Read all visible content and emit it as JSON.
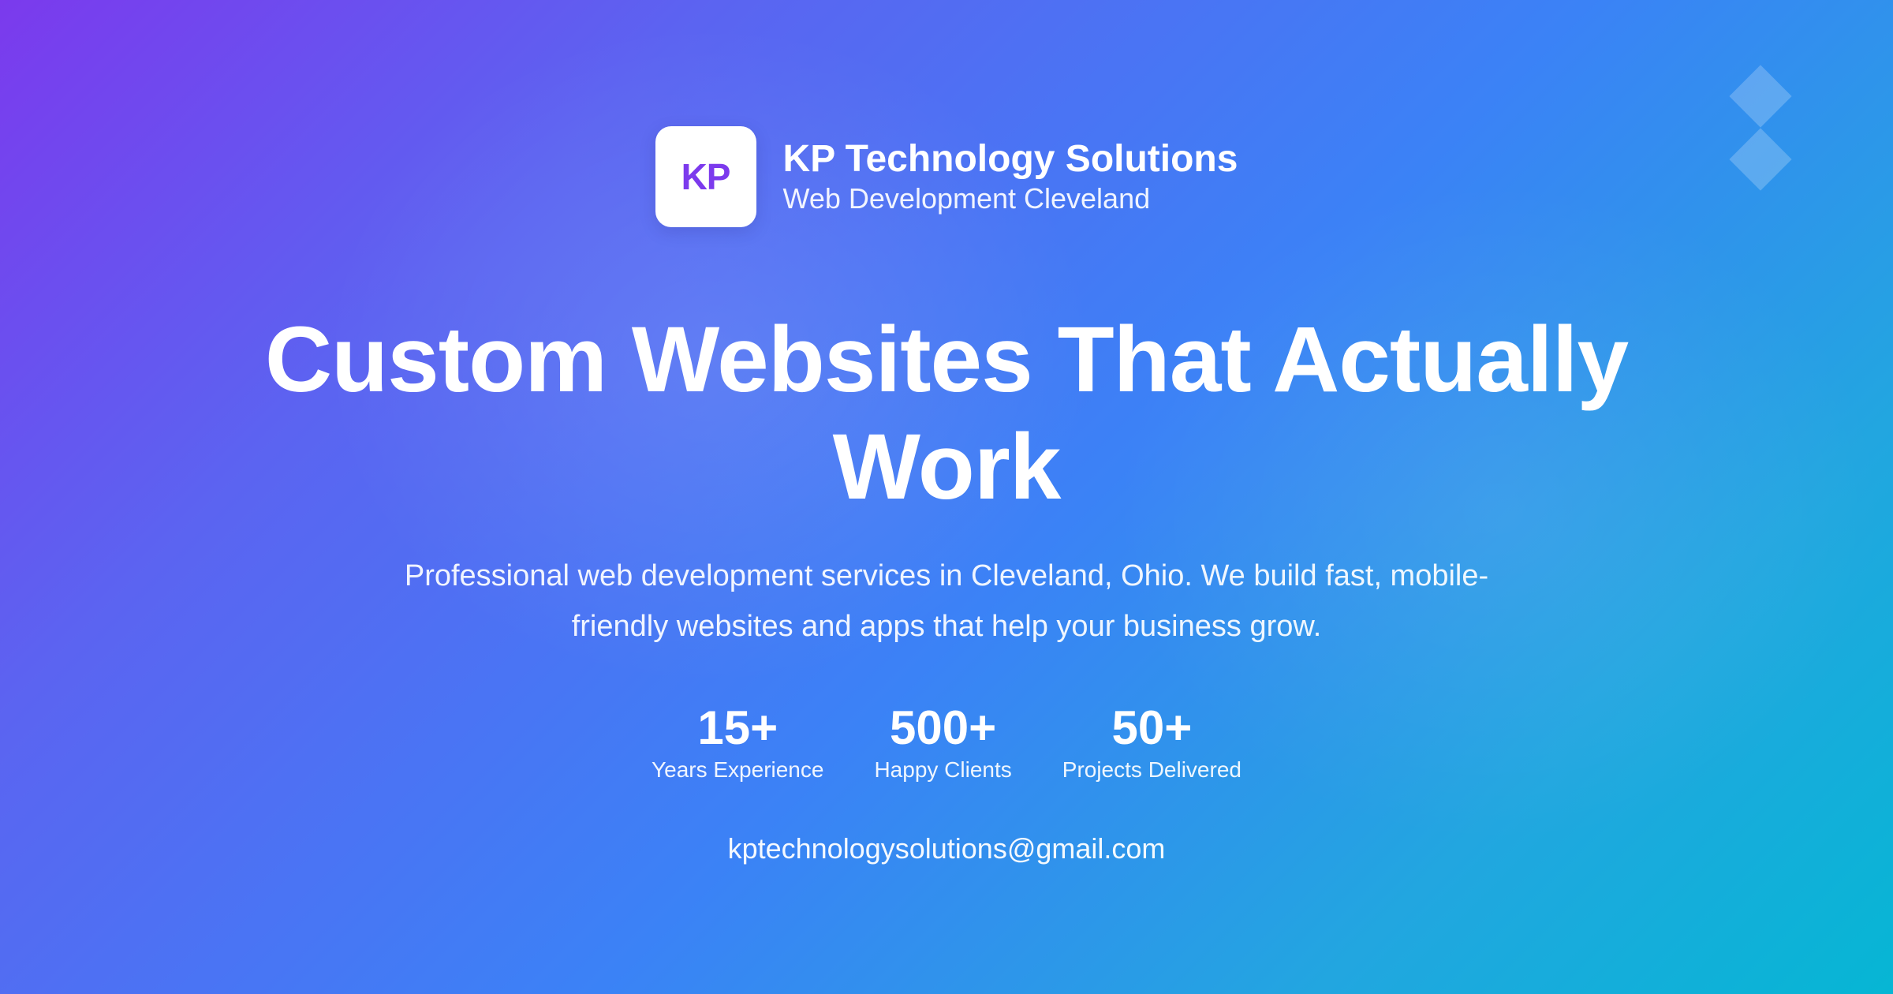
{
  "brand": {
    "logo_initials": "KP",
    "name": "KP Technology Solutions",
    "tagline": "Web Development Cleveland"
  },
  "hero": {
    "headline_line1": "Custom Websites That Actually",
    "headline_line2": "Work",
    "subtext_line1": "Professional web development services in Cleveland, Ohio. We build fast, mobile-",
    "subtext_line2": "friendly websites and apps that help your business grow."
  },
  "stats": [
    {
      "value": "15+",
      "label": "Years Experience"
    },
    {
      "value": "500+",
      "label": "Happy Clients"
    },
    {
      "value": "50+",
      "label": "Projects Delivered"
    }
  ],
  "contact": {
    "email": "kptechnologysolutions@gmail.com"
  },
  "decoration": {
    "icon": "diamond-stack-icon"
  },
  "colors": {
    "gradient_start": "#7b3aed",
    "gradient_mid": "#3b82f6",
    "gradient_end": "#06b6d4",
    "logo_text": "#7c3aed",
    "logo_background": "#ffffff"
  }
}
